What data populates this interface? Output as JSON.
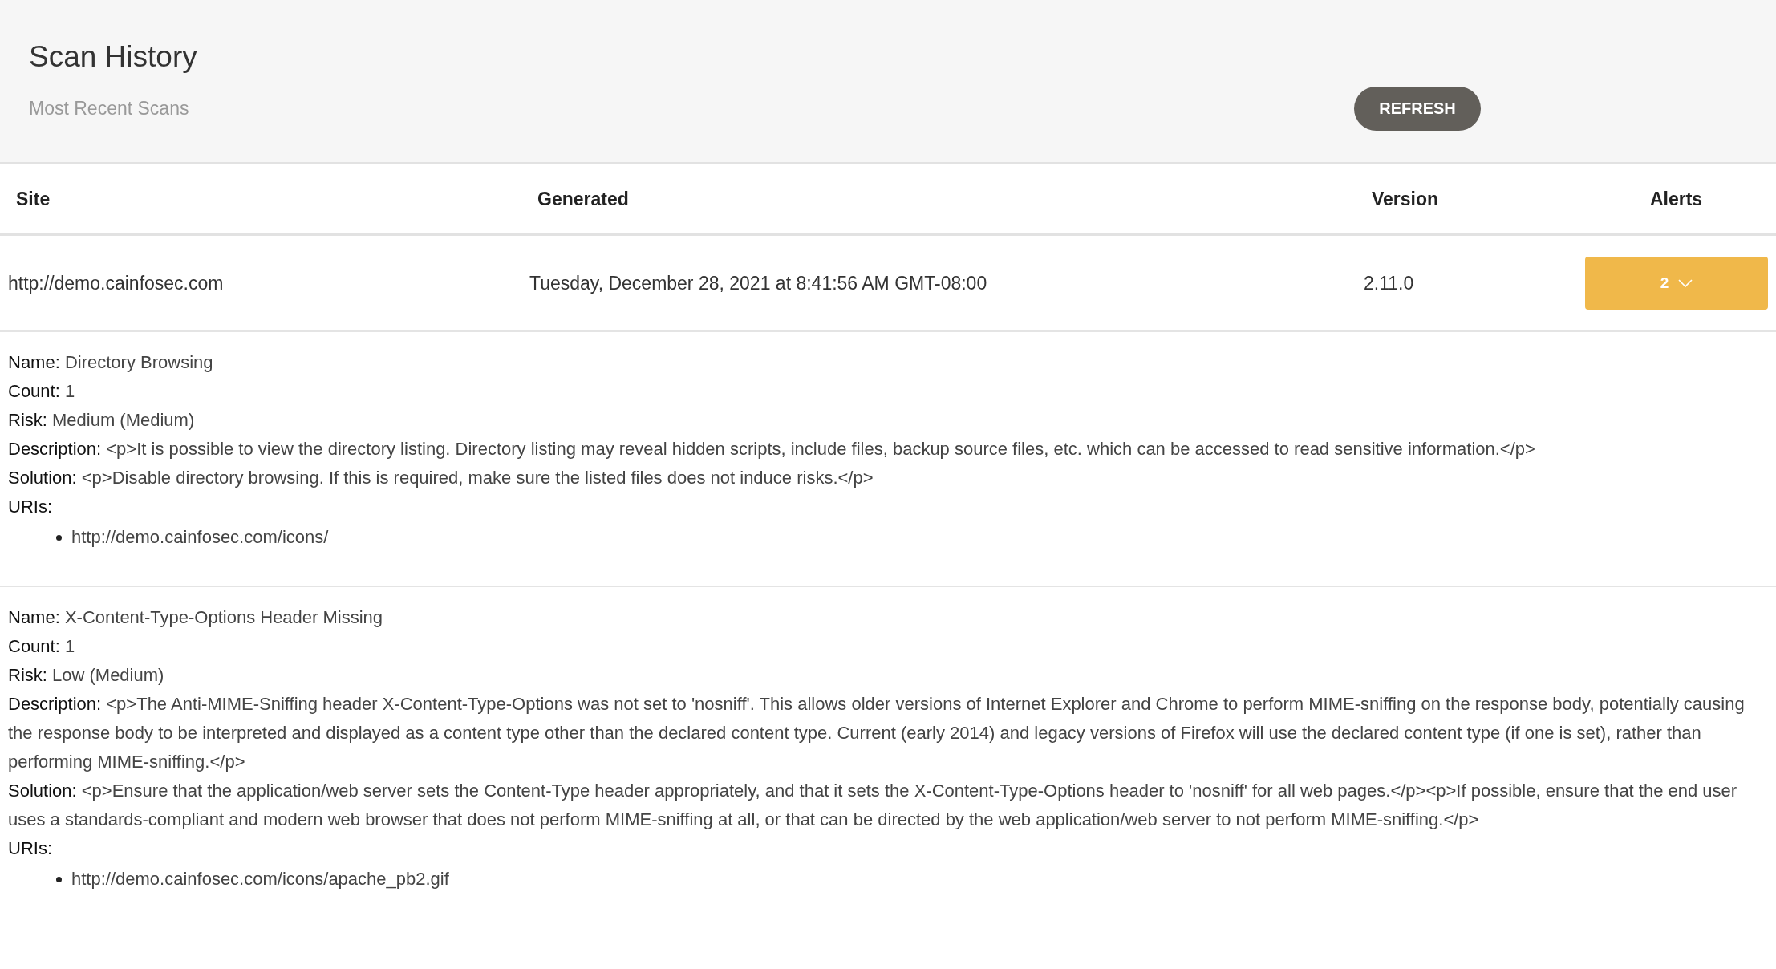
{
  "header": {
    "title": "Scan History",
    "subtitle": "Most Recent Scans",
    "refresh_button": "REFRESH"
  },
  "table": {
    "columns": [
      "Site",
      "Generated",
      "Version",
      "Alerts"
    ],
    "rows": [
      {
        "site": "http://demo.cainfosec.com",
        "generated": "Tuesday, December 28, 2021 at 8:41:56 AM GMT-08:00",
        "version": "2.11.0",
        "alerts": "2",
        "expanded": true,
        "details": [
          {
            "fields": [
              {
                "label": "Name:",
                "value": "Directory Browsing"
              },
              {
                "label": "Count:",
                "value": "1"
              },
              {
                "label": "Risk:",
                "value": "Medium (Medium)"
              },
              {
                "label": "Description:",
                "value": "<p>It is possible to view the directory listing. Directory listing may reveal hidden scripts, include files, backup source files, etc. which can be accessed to read sensitive information.</p>"
              },
              {
                "label": "Solution:",
                "value": "<p>Disable directory browsing. If this is required, make sure the listed files does not induce risks.</p>"
              }
            ],
            "uris_label": "URIs:",
            "uris": [
              "http://demo.cainfosec.com/icons/"
            ]
          },
          {
            "fields": [
              {
                "label": "Name:",
                "value": "X-Content-Type-Options Header Missing"
              },
              {
                "label": "Count:",
                "value": "1"
              },
              {
                "label": "Risk:",
                "value": "Low (Medium)"
              },
              {
                "label": "Description:",
                "value": "<p>The Anti-MIME-Sniffing header X-Content-Type-Options was not set to 'nosniff'. This allows older versions of Internet Explorer and Chrome to perform MIME-sniffing on the response body, potentially causing the response body to be interpreted and displayed as a content type other than the declared content type. Current (early 2014) and legacy versions of Firefox will use the declared content type (if one is set), rather than performing MIME-sniffing.</p>"
              },
              {
                "label": "Solution:",
                "value": "<p>Ensure that the application/web server sets the Content-Type header appropriately, and that it sets the X-Content-Type-Options header to 'nosniff' for all web pages.</p><p>If possible, ensure that the end user uses a standards-compliant and modern web browser that does not perform MIME-sniffing at all, or that can be directed by the web application/web server to not perform MIME-sniffing.</p>"
              }
            ],
            "uris_label": "URIs:",
            "uris": [
              "http://demo.cainfosec.com/icons/apache_pb2.gif"
            ]
          }
        ]
      }
    ]
  }
}
